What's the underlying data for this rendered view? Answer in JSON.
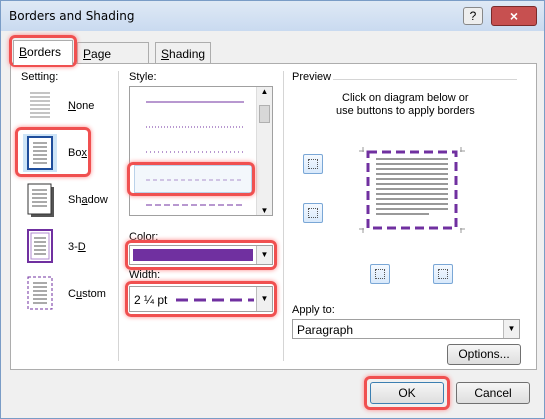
{
  "window": {
    "title": "Borders and Shading",
    "help": "?",
    "close": "×"
  },
  "tabs": [
    {
      "label": "Borders",
      "mnemonic": "B",
      "rest": "orders",
      "active": true
    },
    {
      "label": "Page Border",
      "mnemonic": "P",
      "rest": "age Border",
      "active": false
    },
    {
      "label": "Shading",
      "mnemonic": "S",
      "rest": "hading",
      "active": false
    }
  ],
  "setting": {
    "label": "Setting:",
    "items": [
      {
        "label": "None",
        "mnemonic": "N",
        "rest": "one"
      },
      {
        "label": "Box",
        "mnemonic": "x",
        "before": "Bo"
      },
      {
        "label": "Shadow",
        "mnemonic": "a",
        "before": "Sh",
        "rest": "dow"
      },
      {
        "label": "3-D",
        "mnemonic": "D",
        "before": "3-"
      },
      {
        "label": "Custom",
        "mnemonic": "u",
        "before": "C",
        "rest": "stom"
      }
    ],
    "selected": "Box"
  },
  "style": {
    "label": "Style:",
    "mnemonic": "Y",
    "selected_index": 2
  },
  "color": {
    "label": "Color:",
    "mnemonic": "C",
    "value_color": "#7030a0"
  },
  "width": {
    "label": "Width:",
    "mnemonic": "W",
    "value": "2 ¼ pt"
  },
  "preview": {
    "label": "Preview",
    "instructions_line1": "Click on diagram below or",
    "instructions_line2": "use buttons to apply borders",
    "border_color": "#7030a0"
  },
  "apply_to": {
    "label": "Apply to:",
    "mnemonic": "L",
    "value": "Paragraph"
  },
  "buttons": {
    "options": "Options...",
    "ok": "OK",
    "cancel": "Cancel"
  },
  "colors": {
    "highlight": "#f05050",
    "accent": "#7030a0"
  }
}
